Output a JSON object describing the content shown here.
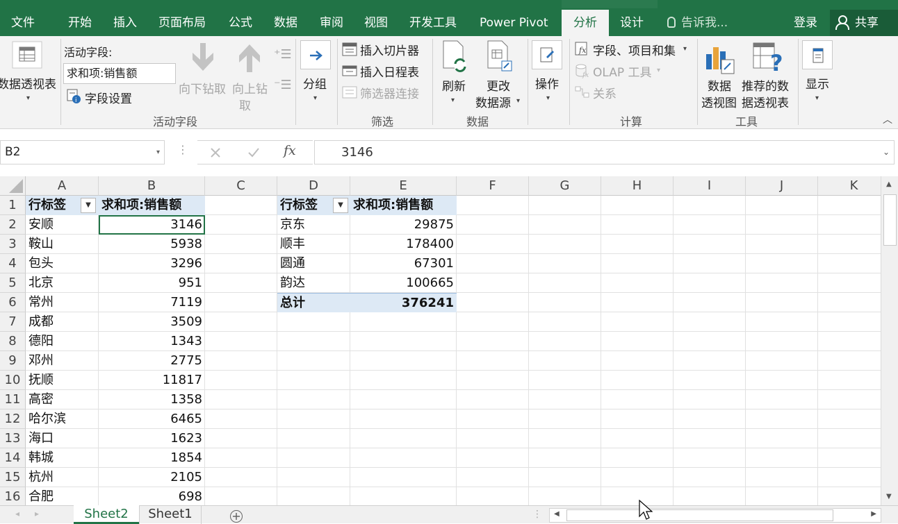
{
  "menubar": {
    "tabs": [
      "文件",
      "开始",
      "插入",
      "页面布局",
      "公式",
      "数据",
      "审阅",
      "视图",
      "开发工具",
      "Power Pivot",
      "分析",
      "设计"
    ],
    "active_tab": "分析",
    "tell_me_placeholder": "告诉我...",
    "login": "登录",
    "share": "共享"
  },
  "ribbon": {
    "pivot_table": {
      "label": "数据透视表"
    },
    "active_field": {
      "title": "活动字段:",
      "field_value": "求和项:销售额",
      "field_settings": "字段设置",
      "drill_down": "向下钻取",
      "drill_up_line1": "向上钻",
      "drill_up_line2": "取",
      "group_label": "活动字段"
    },
    "group": {
      "label": "分组"
    },
    "filter": {
      "insert_slicer": "插入切片器",
      "insert_timeline": "插入日程表",
      "filter_connections": "筛选器连接",
      "group_label": "筛选"
    },
    "data": {
      "refresh": "刷新",
      "change_source_line1": "更改",
      "change_source_line2": "数据源",
      "group_label": "数据"
    },
    "actions": {
      "label": "操作"
    },
    "calculations": {
      "fields_items_sets": "字段、项目和集",
      "olap_tools": "OLAP 工具",
      "relationships": "关系",
      "group_label": "计算"
    },
    "tools": {
      "pivot_chart_line1": "数据",
      "pivot_chart_line2": "透视图",
      "recommended_line1": "推荐的数",
      "recommended_line2": "据透视表",
      "group_label": "工具"
    },
    "show": {
      "label": "显示"
    }
  },
  "formula_bar": {
    "name_box": "B2",
    "fx": "fx",
    "formula": "3146"
  },
  "grid": {
    "columns": [
      "A",
      "B",
      "C",
      "D",
      "E",
      "F",
      "G",
      "H",
      "I",
      "J",
      "K"
    ],
    "rows": [
      "1",
      "2",
      "3",
      "4",
      "5",
      "6",
      "7",
      "8",
      "9",
      "10",
      "11",
      "12",
      "13",
      "14",
      "15",
      "16"
    ],
    "pivot1": {
      "header_label": "行标签",
      "header_value": "求和项:销售额",
      "rows": [
        [
          "安顺",
          "3146"
        ],
        [
          "鞍山",
          "5938"
        ],
        [
          "包头",
          "3296"
        ],
        [
          "北京",
          "951"
        ],
        [
          "常州",
          "7119"
        ],
        [
          "成都",
          "3509"
        ],
        [
          "德阳",
          "1343"
        ],
        [
          "邓州",
          "2775"
        ],
        [
          "抚顺",
          "11817"
        ],
        [
          "高密",
          "1358"
        ],
        [
          "哈尔滨",
          "6465"
        ],
        [
          "海口",
          "1623"
        ],
        [
          "韩城",
          "1854"
        ],
        [
          "杭州",
          "2105"
        ],
        [
          "合肥",
          "698"
        ]
      ]
    },
    "pivot2": {
      "header_label": "行标签",
      "header_value": "求和项:销售额",
      "rows": [
        [
          "京东",
          "29875"
        ],
        [
          "顺丰",
          "178400"
        ],
        [
          "圆通",
          "67301"
        ],
        [
          "韵达",
          "100665"
        ]
      ],
      "total_label": "总计",
      "total_value": "376241"
    }
  },
  "sheets": {
    "tabs": [
      "Sheet2",
      "Sheet1"
    ],
    "active": "Sheet2"
  },
  "colors": {
    "accent": "#217346",
    "pivot_header_bg": "#dde9f5"
  }
}
